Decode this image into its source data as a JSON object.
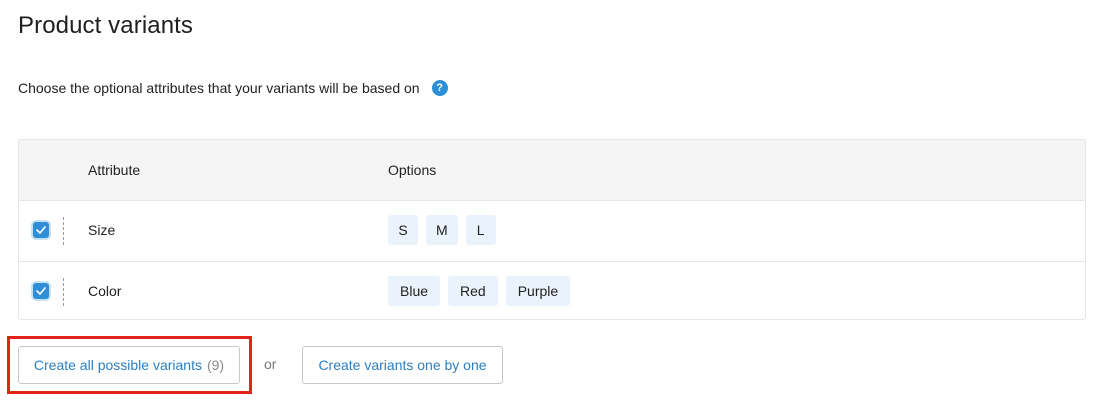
{
  "page": {
    "title": "Product variants",
    "subtitle": "Choose the optional attributes that your variants will be based on",
    "help_icon": "?"
  },
  "table": {
    "headers": {
      "attribute": "Attribute",
      "options": "Options"
    },
    "rows": [
      {
        "checked": true,
        "name": "Size",
        "options": [
          "S",
          "M",
          "L"
        ]
      },
      {
        "checked": true,
        "name": "Color",
        "options": [
          "Blue",
          "Red",
          "Purple"
        ]
      }
    ]
  },
  "actions": {
    "create_all_label": "Create all possible variants",
    "create_all_count": "(9)",
    "or": "or",
    "create_one_label": "Create variants one by one"
  },
  "colors": {
    "accent": "#2e8fd8",
    "link": "#2b7fc2",
    "highlight": "#e1231a",
    "chip_bg": "#eaf3fb"
  }
}
